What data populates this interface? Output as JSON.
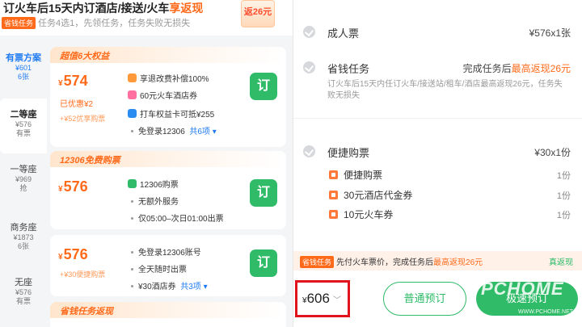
{
  "promo": {
    "title_main": "订火车后15天内订酒店/接送/火车",
    "title_highlight": "享返现",
    "tag": "省钱任务",
    "subtitle": "任务4选1，先领任务，任务失败无损失",
    "envelope": "返26元"
  },
  "seats": [
    {
      "name": "有票方案",
      "price": "¥601",
      "stock": "6张"
    },
    {
      "name": "二等座",
      "price": "¥576",
      "stock": "有票"
    },
    {
      "name": "一等座",
      "price": "¥969",
      "stock": "抢"
    },
    {
      "name": "商务座",
      "price": "¥1873",
      "stock": "6张"
    },
    {
      "name": "无座",
      "price": "¥576",
      "stock": "有票"
    }
  ],
  "cards": [
    {
      "header": "超值6大权益",
      "price_symbol": "¥",
      "price": "574",
      "saving": "已优惠¥2",
      "subtip": "+¥52优享购票",
      "features": [
        "享退改费补偿100%",
        "60元火车酒店券",
        "打车权益卡可抵¥255",
        "免登录12306"
      ],
      "more": "共6项",
      "book": "订"
    },
    {
      "header": "12306免费购票",
      "price_symbol": "¥",
      "price": "576",
      "features": [
        "12306购票",
        "无额外服务",
        "仅05:00–次日01:00出票"
      ],
      "book": "订"
    },
    {
      "price_symbol": "¥",
      "price": "576",
      "subtip": "+¥30便捷购票",
      "features": [
        "免登录12306账号",
        "全天随时出票",
        "¥30酒店券"
      ],
      "more": "共3项",
      "book": "订"
    },
    {
      "header": "省钱任务返现"
    }
  ],
  "summary": {
    "adult": {
      "label": "成人票",
      "value": "¥576x1张"
    },
    "task": {
      "label": "省钱任务",
      "value_prefix": "完成任务后",
      "value_highlight": "最高返现26元",
      "desc": "订火车后15天内任订火车/接送站/租车/酒店最高返现26元，任务失败无损失"
    },
    "convenient": {
      "label": "便捷购票",
      "value": "¥30x1份"
    },
    "items": [
      {
        "label": "便捷购票",
        "qty": "1份"
      },
      {
        "label": "30元酒店代金券",
        "qty": "1份"
      },
      {
        "label": "10元火车券",
        "qty": "1份"
      }
    ]
  },
  "task_bar": {
    "tag": "省钱任务",
    "text": "先付火车票价，完成任务后",
    "highlight": "最高返现26元",
    "tail": "真返现"
  },
  "bottom": {
    "currency": "¥",
    "total": "606",
    "normal_button": "普通预订",
    "fast_button": "极速预订",
    "watermark": "PCHOME",
    "watermark_sub": "WWW.PCHOME.NET"
  }
}
